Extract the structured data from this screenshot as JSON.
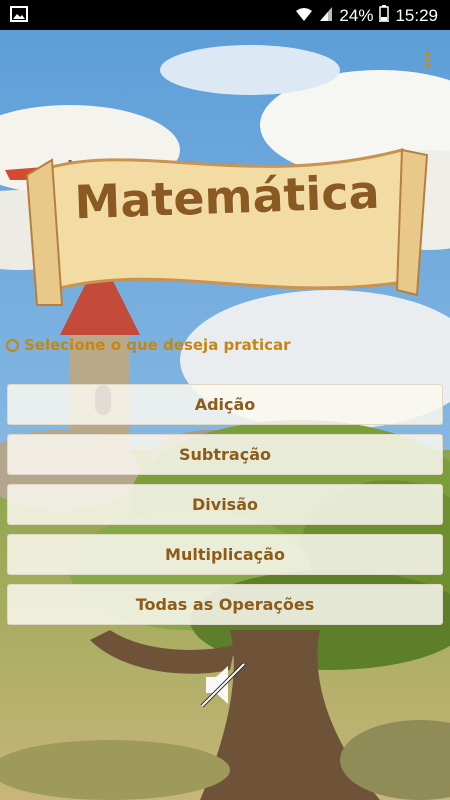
{
  "status_bar": {
    "battery": "24%",
    "time": "15:29"
  },
  "app": {
    "title": "Matemática",
    "hint": "Selecione o que deseja praticar"
  },
  "options": [
    {
      "label": "Adição"
    },
    {
      "label": "Subtração"
    },
    {
      "label": "Divisão"
    },
    {
      "label": "Multiplicação"
    },
    {
      "label": "Todas as Operações"
    }
  ],
  "icons": {
    "menu": "more-vert-icon",
    "sound": "volume-off-icon",
    "gallery": "image-icon",
    "wifi": "wifi-icon",
    "signal": "signal-icon",
    "battery": "battery-icon"
  },
  "colors": {
    "accent": "#c58613",
    "button_text": "#8d5b1a",
    "title": "#8b5a22"
  }
}
